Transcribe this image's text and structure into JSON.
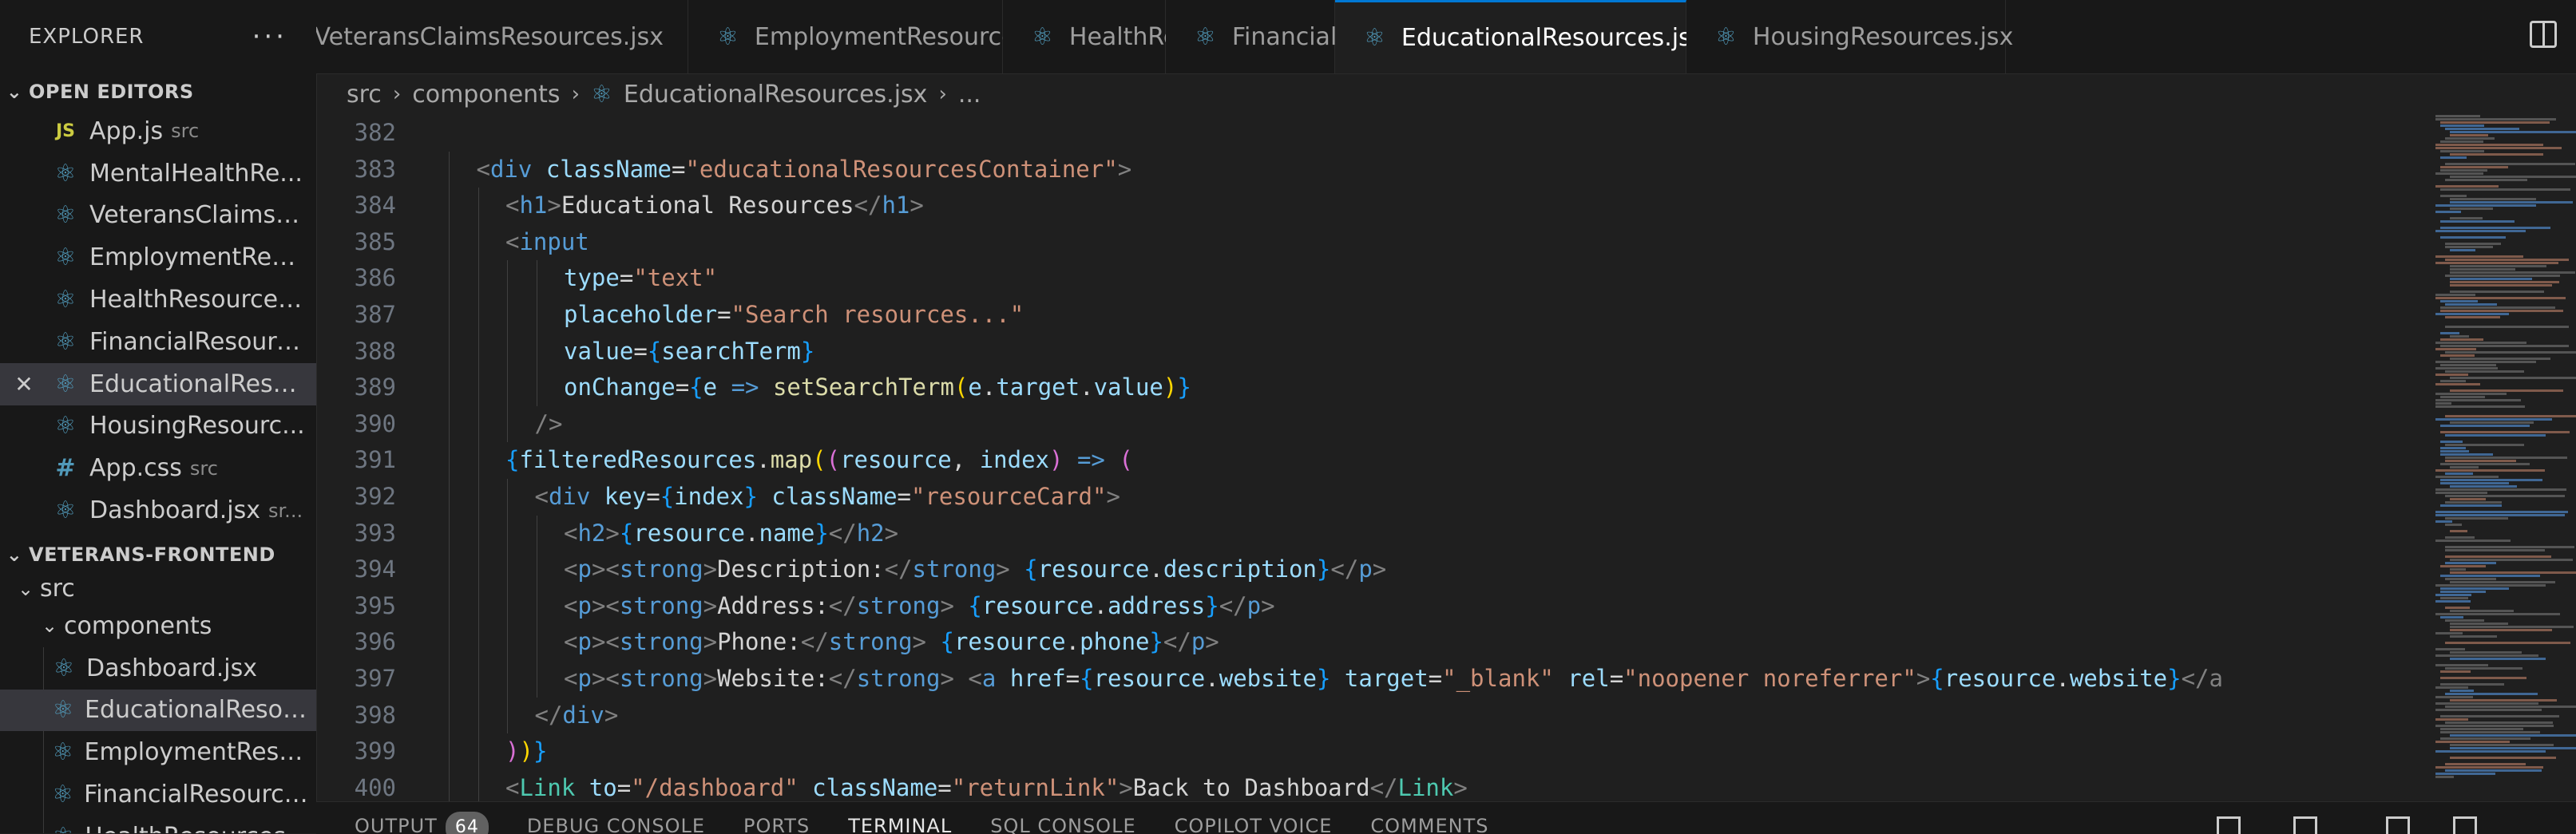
{
  "sidebar": {
    "title": "EXPLORER",
    "more": "···",
    "open_editors": {
      "header": "OPEN EDITORS",
      "items": [
        {
          "name": "App.js",
          "dir": "src",
          "icon": "js-file-icon",
          "badge": "JS"
        },
        {
          "name": "MentalHealthRe...",
          "dir": "",
          "icon": "react-icon"
        },
        {
          "name": "VeteransClaimsR...",
          "dir": "",
          "icon": "react-icon"
        },
        {
          "name": "EmploymentRes...",
          "dir": "",
          "icon": "react-icon"
        },
        {
          "name": "HealthResources...",
          "dir": "",
          "icon": "react-icon"
        },
        {
          "name": "FinancialResourc...",
          "dir": "",
          "icon": "react-icon"
        },
        {
          "name": "EducationalReso...",
          "dir": "",
          "icon": "react-icon",
          "active": true
        },
        {
          "name": "HousingResourc...",
          "dir": "",
          "icon": "react-icon"
        },
        {
          "name": "App.css",
          "dir": "src",
          "icon": "css-file-icon",
          "badge": "#"
        },
        {
          "name": "Dashboard.jsx",
          "dir": "sr...",
          "icon": "react-icon"
        }
      ]
    },
    "project": {
      "header": "VETERANS-FRONTEND",
      "src": "src",
      "components": "components",
      "files": [
        "Dashboard.jsx",
        "EducationalResour...",
        "EmploymentResou...",
        "FinancialResources...",
        "HealthResources.jsx"
      ]
    }
  },
  "tabs": [
    {
      "label": "VeteransClaimsResources.jsx"
    },
    {
      "label": "EmploymentResources.jsx"
    },
    {
      "label": "HealthResources.jsx"
    },
    {
      "label": "FinancialResources.jsx"
    },
    {
      "label": "EducationalResources.jsx",
      "active": true
    },
    {
      "label": "HousingResources.jsx"
    }
  ],
  "breadcrumb": {
    "parts": [
      "src",
      "components",
      "EducationalResources.jsx",
      "..."
    ]
  },
  "editor": {
    "lines": [
      {
        "n": "382",
        "indent": 0,
        "tokens": []
      },
      {
        "n": "383",
        "indent": 1,
        "tokens": [
          [
            "br",
            "<"
          ],
          [
            "tag",
            "div"
          ],
          [
            "op",
            " "
          ],
          [
            "attr",
            "className"
          ],
          [
            "op",
            "="
          ],
          [
            "str",
            "\"educationalResourcesContainer\""
          ],
          [
            "br",
            ">"
          ]
        ]
      },
      {
        "n": "384",
        "indent": 2,
        "tokens": [
          [
            "br",
            "<"
          ],
          [
            "tag",
            "h1"
          ],
          [
            "br",
            ">"
          ],
          [
            "text",
            "Educational Resources"
          ],
          [
            "br",
            "</"
          ],
          [
            "tag",
            "h1"
          ],
          [
            "br",
            ">"
          ]
        ]
      },
      {
        "n": "385",
        "indent": 2,
        "tokens": [
          [
            "br",
            "<"
          ],
          [
            "tag",
            "input"
          ]
        ]
      },
      {
        "n": "386",
        "indent": 4,
        "tokens": [
          [
            "attr",
            "type"
          ],
          [
            "op",
            "="
          ],
          [
            "str",
            "\"text\""
          ]
        ]
      },
      {
        "n": "387",
        "indent": 4,
        "tokens": [
          [
            "attr",
            "placeholder"
          ],
          [
            "op",
            "="
          ],
          [
            "str",
            "\"Search resources...\""
          ]
        ]
      },
      {
        "n": "388",
        "indent": 4,
        "tokens": [
          [
            "attr",
            "value"
          ],
          [
            "op",
            "="
          ],
          [
            "b",
            "{"
          ],
          [
            "var",
            "searchTerm"
          ],
          [
            "b",
            "}"
          ]
        ]
      },
      {
        "n": "389",
        "indent": 4,
        "tokens": [
          [
            "attr",
            "onChange"
          ],
          [
            "op",
            "="
          ],
          [
            "b",
            "{"
          ],
          [
            "var",
            "e"
          ],
          [
            "op",
            " "
          ],
          [
            "kw",
            "=>"
          ],
          [
            "op",
            " "
          ],
          [
            "fn",
            "setSearchTerm"
          ],
          [
            "y",
            "("
          ],
          [
            "var",
            "e"
          ],
          [
            "op",
            "."
          ],
          [
            "var",
            "target"
          ],
          [
            "op",
            "."
          ],
          [
            "var",
            "value"
          ],
          [
            "y",
            ")"
          ],
          [
            "b",
            "}"
          ]
        ]
      },
      {
        "n": "390",
        "indent": 3,
        "tokens": [
          [
            "br",
            "/>"
          ]
        ]
      },
      {
        "n": "391",
        "indent": 2,
        "tokens": [
          [
            "b",
            "{"
          ],
          [
            "var",
            "filteredResources"
          ],
          [
            "op",
            "."
          ],
          [
            "fn",
            "map"
          ],
          [
            "y",
            "("
          ],
          [
            "p",
            "("
          ],
          [
            "var",
            "resource"
          ],
          [
            "op",
            ", "
          ],
          [
            "var",
            "index"
          ],
          [
            "p",
            ")"
          ],
          [
            "op",
            " "
          ],
          [
            "kw",
            "=>"
          ],
          [
            "op",
            " "
          ],
          [
            "p",
            "("
          ]
        ]
      },
      {
        "n": "392",
        "indent": 3,
        "tokens": [
          [
            "br",
            "<"
          ],
          [
            "tag",
            "div"
          ],
          [
            "op",
            " "
          ],
          [
            "attr",
            "key"
          ],
          [
            "op",
            "="
          ],
          [
            "b",
            "{"
          ],
          [
            "var",
            "index"
          ],
          [
            "b",
            "}"
          ],
          [
            "op",
            " "
          ],
          [
            "attr",
            "className"
          ],
          [
            "op",
            "="
          ],
          [
            "str",
            "\"resourceCard\""
          ],
          [
            "br",
            ">"
          ]
        ]
      },
      {
        "n": "393",
        "indent": 4,
        "tokens": [
          [
            "br",
            "<"
          ],
          [
            "tag",
            "h2"
          ],
          [
            "br",
            ">"
          ],
          [
            "b",
            "{"
          ],
          [
            "var",
            "resource"
          ],
          [
            "op",
            "."
          ],
          [
            "var",
            "name"
          ],
          [
            "b",
            "}"
          ],
          [
            "br",
            "</"
          ],
          [
            "tag",
            "h2"
          ],
          [
            "br",
            ">"
          ]
        ]
      },
      {
        "n": "394",
        "indent": 4,
        "tokens": [
          [
            "br",
            "<"
          ],
          [
            "tag",
            "p"
          ],
          [
            "br",
            "><"
          ],
          [
            "tag",
            "strong"
          ],
          [
            "br",
            ">"
          ],
          [
            "text",
            "Description:"
          ],
          [
            "br",
            "</"
          ],
          [
            "tag",
            "strong"
          ],
          [
            "br",
            ">"
          ],
          [
            "op",
            " "
          ],
          [
            "b",
            "{"
          ],
          [
            "var",
            "resource"
          ],
          [
            "op",
            "."
          ],
          [
            "var",
            "description"
          ],
          [
            "b",
            "}"
          ],
          [
            "br",
            "</"
          ],
          [
            "tag",
            "p"
          ],
          [
            "br",
            ">"
          ]
        ]
      },
      {
        "n": "395",
        "indent": 4,
        "tokens": [
          [
            "br",
            "<"
          ],
          [
            "tag",
            "p"
          ],
          [
            "br",
            "><"
          ],
          [
            "tag",
            "strong"
          ],
          [
            "br",
            ">"
          ],
          [
            "text",
            "Address:"
          ],
          [
            "br",
            "</"
          ],
          [
            "tag",
            "strong"
          ],
          [
            "br",
            ">"
          ],
          [
            "op",
            " "
          ],
          [
            "b",
            "{"
          ],
          [
            "var",
            "resource"
          ],
          [
            "op",
            "."
          ],
          [
            "var",
            "address"
          ],
          [
            "b",
            "}"
          ],
          [
            "br",
            "</"
          ],
          [
            "tag",
            "p"
          ],
          [
            "br",
            ">"
          ]
        ]
      },
      {
        "n": "396",
        "indent": 4,
        "tokens": [
          [
            "br",
            "<"
          ],
          [
            "tag",
            "p"
          ],
          [
            "br",
            "><"
          ],
          [
            "tag",
            "strong"
          ],
          [
            "br",
            ">"
          ],
          [
            "text",
            "Phone:"
          ],
          [
            "br",
            "</"
          ],
          [
            "tag",
            "strong"
          ],
          [
            "br",
            ">"
          ],
          [
            "op",
            " "
          ],
          [
            "b",
            "{"
          ],
          [
            "var",
            "resource"
          ],
          [
            "op",
            "."
          ],
          [
            "var",
            "phone"
          ],
          [
            "b",
            "}"
          ],
          [
            "br",
            "</"
          ],
          [
            "tag",
            "p"
          ],
          [
            "br",
            ">"
          ]
        ]
      },
      {
        "n": "397",
        "indent": 4,
        "tokens": [
          [
            "br",
            "<"
          ],
          [
            "tag",
            "p"
          ],
          [
            "br",
            "><"
          ],
          [
            "tag",
            "strong"
          ],
          [
            "br",
            ">"
          ],
          [
            "text",
            "Website:"
          ],
          [
            "br",
            "</"
          ],
          [
            "tag",
            "strong"
          ],
          [
            "br",
            ">"
          ],
          [
            "op",
            " "
          ],
          [
            "br",
            "<"
          ],
          [
            "tag",
            "a"
          ],
          [
            "op",
            " "
          ],
          [
            "attr",
            "href"
          ],
          [
            "op",
            "="
          ],
          [
            "b",
            "{"
          ],
          [
            "var",
            "resource"
          ],
          [
            "op",
            "."
          ],
          [
            "var",
            "website"
          ],
          [
            "b",
            "}"
          ],
          [
            "op",
            " "
          ],
          [
            "attr",
            "target"
          ],
          [
            "op",
            "="
          ],
          [
            "str",
            "\"_blank\""
          ],
          [
            "op",
            " "
          ],
          [
            "attr",
            "rel"
          ],
          [
            "op",
            "="
          ],
          [
            "str",
            "\"noopener noreferrer\""
          ],
          [
            "br",
            ">"
          ],
          [
            "b",
            "{"
          ],
          [
            "var",
            "resource"
          ],
          [
            "op",
            "."
          ],
          [
            "var",
            "website"
          ],
          [
            "b",
            "}"
          ],
          [
            "br",
            "</a"
          ]
        ]
      },
      {
        "n": "398",
        "indent": 3,
        "tokens": [
          [
            "br",
            "</"
          ],
          [
            "tag",
            "div"
          ],
          [
            "br",
            ">"
          ]
        ]
      },
      {
        "n": "399",
        "indent": 2,
        "tokens": [
          [
            "p",
            ")"
          ],
          [
            "y",
            ")"
          ],
          [
            "b",
            "}"
          ]
        ]
      },
      {
        "n": "400",
        "indent": 2,
        "tokens": [
          [
            "br",
            "<"
          ],
          [
            "comp",
            "Link"
          ],
          [
            "op",
            " "
          ],
          [
            "attr",
            "to"
          ],
          [
            "op",
            "="
          ],
          [
            "str",
            "\"/dashboard\""
          ],
          [
            "op",
            " "
          ],
          [
            "attr",
            "className"
          ],
          [
            "op",
            "="
          ],
          [
            "str",
            "\"returnLink\""
          ],
          [
            "br",
            ">"
          ],
          [
            "text",
            "Back to Dashboard"
          ],
          [
            "br",
            "</"
          ],
          [
            "comp",
            "Link"
          ],
          [
            "br",
            ">"
          ]
        ]
      }
    ]
  },
  "panel": {
    "tabs": [
      "OUTPUT",
      "DEBUG CONSOLE",
      "PORTS",
      "TERMINAL",
      "SQL CONSOLE",
      "COPILOT VOICE",
      "COMMENTS"
    ],
    "active": "TERMINAL",
    "output_badge": "64"
  }
}
